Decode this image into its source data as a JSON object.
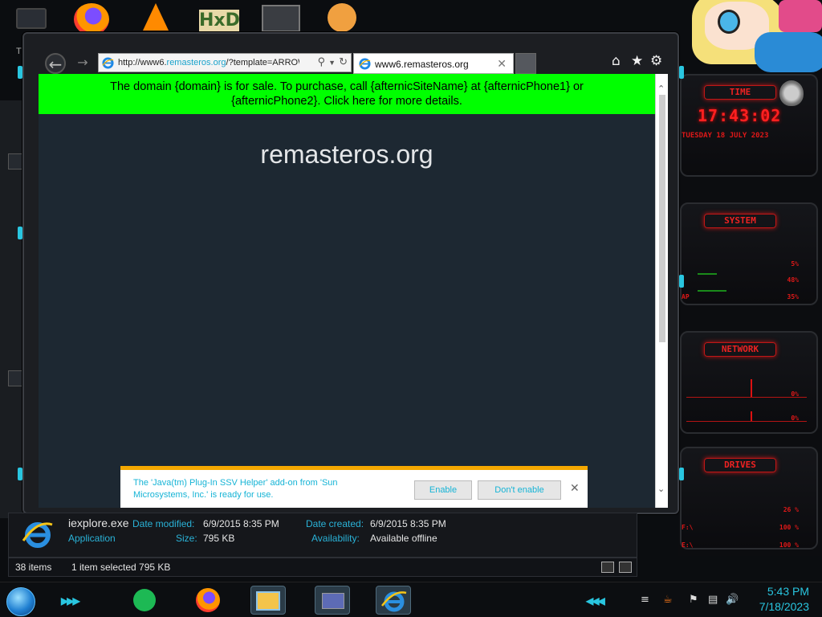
{
  "desktop": {
    "letter": "T",
    "icons": [
      "folder-icon",
      "firefox-icon",
      "vlc-icon",
      "hxd-icon",
      "app-icon",
      "user-icon"
    ],
    "hxd_label": "HxD"
  },
  "browser": {
    "address_url_prefix": "http://www6.",
    "address_url_highlight": "remasteros.org",
    "address_url_suffix": "/?template=ARROW",
    "tab_title": "www6.remasteros.org",
    "banner_text": "The domain {domain} is for sale. To purchase, call {afternicSiteName} at {afternicPhone1} or {afternicPhone2}. Click here for more details.",
    "site_title": "remasteros.org",
    "notification": {
      "message": "The 'Java(tm) Plug-In SSV Helper' add-on from 'Sun Microsystems, Inc.' is ready for use.",
      "enable_label": "Enable",
      "dont_enable_label": "Don't enable"
    }
  },
  "explorer": {
    "file_name": "iexplore.exe",
    "file_type": "Application",
    "date_modified_label": "Date modified:",
    "date_modified": "6/9/2015 8:35 PM",
    "size_label": "Size:",
    "size": "795 KB",
    "date_created_label": "Date created:",
    "date_created": "6/9/2015 8:35 PM",
    "availability_label": "Availability:",
    "availability": "Available offline",
    "item_count": "38 items",
    "selection": "1 item selected  795 KB"
  },
  "gadgets": {
    "time": {
      "title": "TIME",
      "clock": "17:43:02",
      "date": "TUESDAY 18 JULY 2023"
    },
    "system": {
      "title": "SYSTEM",
      "rows": [
        {
          "label": "",
          "value": "5%"
        },
        {
          "label": "",
          "value": "48%"
        },
        {
          "label": "AP",
          "value": "35%"
        }
      ]
    },
    "network": {
      "title": "NETWORK",
      "rows": [
        {
          "value": "0%"
        },
        {
          "value": "0%"
        }
      ]
    },
    "drives": {
      "title": "DRIVES",
      "rows": [
        {
          "label": "",
          "value": "26 %"
        },
        {
          "label": "F:\\",
          "value": "100 %"
        },
        {
          "label": "E:\\",
          "value": "100 %"
        }
      ]
    }
  },
  "taskbar": {
    "time": "5:43 PM",
    "date": "7/18/2023",
    "accent": "#29c6e0"
  }
}
